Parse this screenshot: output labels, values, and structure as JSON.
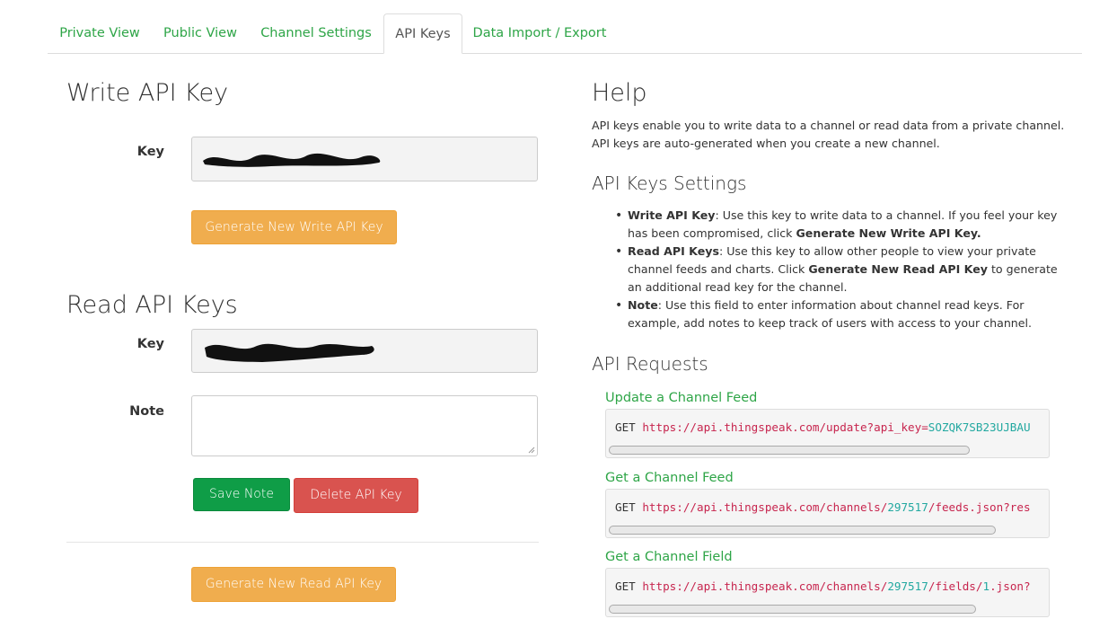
{
  "tabs": [
    "Private View",
    "Public View",
    "Channel Settings",
    "API Keys",
    "Data Import / Export"
  ],
  "write": {
    "title": "Write API Key",
    "key_label": "Key",
    "generate_label": "Generate New Write API Key"
  },
  "read": {
    "title": "Read API Keys",
    "key_label": "Key",
    "note_label": "Note",
    "note_value": "",
    "save_label": "Save Note",
    "delete_label": "Delete API Key",
    "generate_label": "Generate New Read API Key"
  },
  "help": {
    "title": "Help",
    "intro": "API keys enable you to write data to a channel or read data from a private channel. API keys are auto-generated when you create a new channel.",
    "settings_title": "API Keys Settings",
    "bullets": [
      {
        "strong": "Write API Key",
        "text": ": Use this key to write data to a channel. If you feel your key has been compromised, click ",
        "strong2": "Generate New Write API Key.",
        "text2": ""
      },
      {
        "strong": "Read API Keys",
        "text": ": Use this key to allow other people to view your private channel feeds and charts. Click ",
        "strong2": "Generate New Read API Key",
        "text2": " to generate an additional read key for the channel."
      },
      {
        "strong": "Note",
        "text": ": Use this field to enter information about channel read keys. For example, add notes to keep track of users with access to your channel.",
        "strong2": "",
        "text2": ""
      }
    ],
    "requests_title": "API Requests",
    "requests": [
      {
        "title": "Update a Channel Feed",
        "method": "GET",
        "url_a": "https://api.thingspeak.com/update?api_key=",
        "num": "SOZQK7SB23UJBAU",
        "url_b": ""
      },
      {
        "title": "Get a Channel Feed",
        "method": "GET",
        "url_a": "https://api.thingspeak.com/channels/",
        "num": "297517",
        "url_b": "/feeds.json?res"
      },
      {
        "title": "Get a Channel Field",
        "method": "GET",
        "url_a": "https://api.thingspeak.com/channels/",
        "num": "297517",
        "url_b": "/fields/",
        "num2": "1",
        "url_c": ".json?"
      }
    ]
  },
  "colors": {
    "accent_green": "#2ea547",
    "warn": "#f0ad4e",
    "danger": "#d9534f",
    "save": "#0f9d47"
  }
}
